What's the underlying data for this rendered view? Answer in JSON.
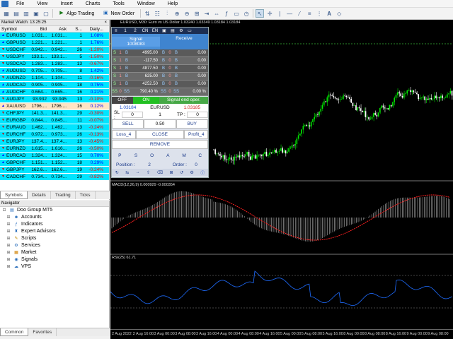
{
  "menu": [
    "File",
    "View",
    "Insert",
    "Charts",
    "Tools",
    "Window",
    "Help"
  ],
  "toolbar": {
    "algo_trading": "Algo Trading",
    "new_order": "New Order"
  },
  "market_watch": {
    "title": "Market Watch: 13:25:25",
    "headers": [
      "Symbol",
      "Bid",
      "Ask",
      "S...",
      "Daily..."
    ],
    "rows": [
      {
        "symbol": "EURUSD",
        "bid": "1.031...",
        "ask": "1.031...",
        "spread": "1",
        "daily": "1.08%",
        "bg": "#00e5ff",
        "dc": "#0000ff"
      },
      {
        "symbol": "GBPUSD",
        "bid": "1.221...",
        "ask": "1.221...",
        "spread": "1",
        "daily": "1.76%",
        "bg": "#00e5ff",
        "dc": "#0000ff"
      },
      {
        "symbol": "USDCHF",
        "bid": "0.942...",
        "ask": "0.942...",
        "spread": "26",
        "daily": "-1.20%",
        "bg": "#00e5ff",
        "dc": "#ff0000"
      },
      {
        "symbol": "USDJPY",
        "bid": "133.1...",
        "ask": "133.1...",
        "spread": "5",
        "daily": "-1.50%",
        "bg": "#00e5ff",
        "dc": "#ff0000"
      },
      {
        "symbol": "USDCAD",
        "bid": "1.283...",
        "ask": "1.283...",
        "spread": "13",
        "daily": "-0.67%",
        "bg": "#00e5ff",
        "dc": "#ff0000"
      },
      {
        "symbol": "AUDUSD",
        "bid": "0.705...",
        "ask": "0.705...",
        "spread": "8",
        "daily": "1.42%",
        "bg": "#00e5ff",
        "dc": "#0000ff"
      },
      {
        "symbol": "AUDNZD",
        "bid": "1.104...",
        "ask": "1.104...",
        "spread": "11",
        "daily": "-0.16%",
        "bg": "#00e5ff",
        "dc": "#ff0000"
      },
      {
        "symbol": "AUDCAD",
        "bid": "0.905...",
        "ask": "0.905...",
        "spread": "18",
        "daily": "0.75%",
        "bg": "#00e5ff",
        "dc": "#0000ff"
      },
      {
        "symbol": "AUDCHF",
        "bid": "0.664...",
        "ask": "0.665...",
        "spread": "16",
        "daily": "0.21%",
        "bg": "#00e5ff",
        "dc": "#0000ff"
      },
      {
        "symbol": "AUDJPY",
        "bid": "93.932",
        "ask": "93.945",
        "spread": "13",
        "daily": "-0.10%",
        "bg": "#00e5ff",
        "dc": "#ff0000"
      },
      {
        "symbol": "XAUUSD",
        "bid": "1796....",
        "ask": "1796....",
        "spread": "16",
        "daily": "0.12%",
        "bg": "#ffe4c4",
        "dc": "#0000ff"
      },
      {
        "symbol": "CHFJPY",
        "bid": "141.3...",
        "ask": "141.3...",
        "spread": "29",
        "daily": "-0.30%",
        "bg": "#00e5ff",
        "dc": "#ff0000"
      },
      {
        "symbol": "EURGBP",
        "bid": "0.844...",
        "ask": "0.845...",
        "spread": "11",
        "daily": "-0.07%",
        "bg": "#00e5ff",
        "dc": "#ff0000"
      },
      {
        "symbol": "EURAUD",
        "bid": "1.462...",
        "ask": "1.462...",
        "spread": "13",
        "daily": "-0.24%",
        "bg": "#00e5ff",
        "dc": "#ff0000"
      },
      {
        "symbol": "EURCHF",
        "bid": "0.972...",
        "ask": "0.973...",
        "spread": "26",
        "daily": "-0.13%",
        "bg": "#00e5ff",
        "dc": "#ff0000"
      },
      {
        "symbol": "EURJPY",
        "bid": "137.4...",
        "ask": "137.4...",
        "spread": "13",
        "daily": "-0.45%",
        "bg": "#00e5ff",
        "dc": "#ff0000"
      },
      {
        "symbol": "EURNZD",
        "bid": "1.615...",
        "ask": "1.616...",
        "spread": "26",
        "daily": "-0.50%",
        "bg": "#00e5ff",
        "dc": "#ff0000"
      },
      {
        "symbol": "EURCAD",
        "bid": "1.324...",
        "ask": "1.324...",
        "spread": "15",
        "daily": "0.70%",
        "bg": "#00e5ff",
        "dc": "#0000ff"
      },
      {
        "symbol": "GBPCHF",
        "bid": "1.151...",
        "ask": "1.152...",
        "spread": "18",
        "daily": "0.29%",
        "bg": "#00e5ff",
        "dc": "#0000ff"
      },
      {
        "symbol": "GBPJPY",
        "bid": "162.6...",
        "ask": "162.6...",
        "spread": "19",
        "daily": "-0.24%",
        "bg": "#00e5ff",
        "dc": "#ff0000"
      },
      {
        "symbol": "CADCHF",
        "bid": "0.734...",
        "ask": "0.734...",
        "spread": "29",
        "daily": "-0.82%",
        "bg": "#00e5ff",
        "dc": "#ff0000"
      }
    ],
    "tabs": [
      "Symbols",
      "Details",
      "Trading",
      "Ticks"
    ]
  },
  "navigator": {
    "title": "Navigator",
    "items": [
      {
        "label": "Doo Group MT5",
        "icon": "folder-icon",
        "indent": 0
      },
      {
        "label": "Accounts",
        "icon": "accounts-icon",
        "indent": 1
      },
      {
        "label": "Indicators",
        "icon": "indicators-icon",
        "indent": 1
      },
      {
        "label": "Expert Advisors",
        "icon": "expert-advisors-icon",
        "indent": 1
      },
      {
        "label": "Scripts",
        "icon": "scripts-icon",
        "indent": 1
      },
      {
        "label": "Services",
        "icon": "services-icon",
        "indent": 1
      },
      {
        "label": "Market",
        "icon": "market-icon",
        "indent": 1
      },
      {
        "label": "Signals",
        "icon": "signals-icon",
        "indent": 1
      },
      {
        "label": "VPS",
        "icon": "vps-icon",
        "indent": 1
      }
    ],
    "tabs": [
      "Common",
      "Favorites"
    ]
  },
  "chart": {
    "title": "EURUSD, M30: Euro vs US Dollar  1.03240 1.03349 1.03184 1.03184",
    "macd_label": "MACD(12,26,9) 0.000929 -0.000354",
    "rsi_label": "RSI(25) 61.71",
    "x_labels": [
      "2 Aug 2022",
      "2 Aug 16:00",
      "3 Aug 00:00",
      "3 Aug 08:00",
      "3 Aug 16:00",
      "4 Aug 00:00",
      "4 Aug 08:00",
      "4 Aug 16:00",
      "5 Aug 00:00",
      "5 Aug 08:00",
      "5 Aug 16:00",
      "8 Aug 00:00",
      "8 Aug 08:00",
      "8 Aug 16:00",
      "9 Aug 00:00",
      "9 Aug 08:00"
    ]
  },
  "panel": {
    "tabs": [
      "1",
      "2",
      "CN",
      "EN"
    ],
    "signal": "Signal",
    "signal_id": "1008083",
    "receive": "Receive",
    "rows": [
      {
        "a": "S",
        "b": "1",
        "c": "B",
        "v": "4995.00",
        "d": "B",
        "e": "0",
        "f": "B",
        "w": "0.00"
      },
      {
        "a": "S",
        "b": "1",
        "c": "B",
        "v": "-117.50",
        "d": "B",
        "e": "0",
        "f": "B",
        "w": "0.00"
      },
      {
        "a": "S",
        "b": "1",
        "c": "B",
        "v": "4877.50",
        "d": "B",
        "e": "0",
        "f": "B",
        "w": "0.00"
      },
      {
        "a": "S",
        "b": "1",
        "c": "B",
        "v": "625.00",
        "d": "B",
        "e": "0",
        "f": "B",
        "w": "0.00"
      },
      {
        "a": "S",
        "b": "1",
        "c": "B",
        "v": "4252.50",
        "d": "B",
        "e": "0",
        "f": "B",
        "w": "0.00"
      },
      {
        "a": "SS",
        "b": "0",
        "c": "SS",
        "v": "790.40 %",
        "d": "SS",
        "e": "0",
        "f": "SS",
        "w": "0.00 %"
      }
    ],
    "off": "OFF",
    "on": "ON",
    "signal_end": "Signal end oper.",
    "bid_price": "1.03184",
    "symbol": "EURUSD",
    "ask_price": "1.03185",
    "sl_label": "SL :",
    "sl_val": "0",
    "lot_top": "1",
    "tp_label": "TP :",
    "tp_val": "0",
    "sell": "SELL",
    "lot": "0.50",
    "buy": "BUY",
    "loss": "Loss_4",
    "close": "CLOSE",
    "profit": "Profit_4",
    "remove": "REMOVE",
    "letters": [
      "P",
      "S",
      "O",
      "A",
      "M",
      "C"
    ],
    "position_label": "Position :",
    "position_val": "2",
    "order_label": "Order :",
    "order_val": "0"
  },
  "colors": {
    "bull": "#00e600",
    "bear": "#ffffff",
    "macd_signal": "#ff2020",
    "rsi_line": "#1e6cff"
  }
}
